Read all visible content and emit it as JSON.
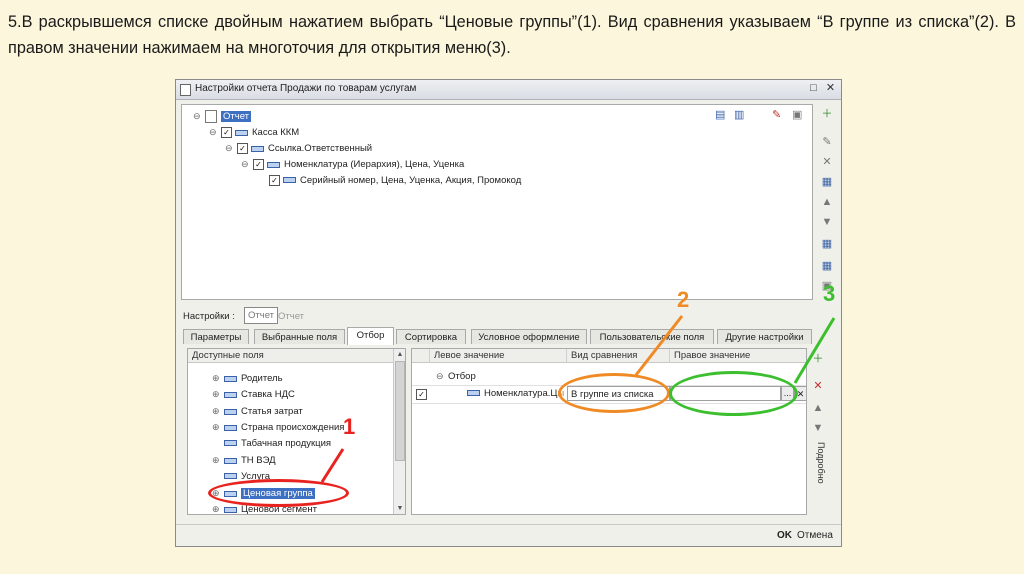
{
  "caption": "5.В раскрывшемся списке двойным нажатием выбрать “Ценовые группы”(1). Вид сравнения указываем “В группе из списка”(2). В правом значении нажимаем на многоточия для открытия меню(3).",
  "window": {
    "title": "Настройки отчета  Продажи по товарам услугам",
    "btn_restore": "□",
    "btn_close": "✕"
  },
  "tree": {
    "root": "Отчет",
    "items": [
      {
        "label": "Касса ККМ"
      },
      {
        "label": "Ссылка.Ответственный"
      },
      {
        "label": "Номенклатура (Иерархия), Цена, Уценка"
      },
      {
        "label": "Серийный номер, Цена, Уценка, Акция, Промокод"
      }
    ]
  },
  "settings": {
    "label": "Настройки :",
    "btn_active": "Отчет",
    "btn_inactive": "Отчет"
  },
  "tabs": [
    {
      "label": "Параметры"
    },
    {
      "label": "Выбранные поля"
    },
    {
      "label": "Отбор"
    },
    {
      "label": "Сортировка"
    },
    {
      "label": "Условное оформление"
    },
    {
      "label": "Пользовательские поля"
    },
    {
      "label": "Другие настройки"
    }
  ],
  "fields": {
    "header": "Доступные поля",
    "items": [
      {
        "label": "Родитель"
      },
      {
        "label": "Ставка НДС"
      },
      {
        "label": "Статья затрат"
      },
      {
        "label": "Страна происхождения"
      },
      {
        "label": "Табачная продукция"
      },
      {
        "label": "ТН ВЭД"
      },
      {
        "label": "Услуга"
      },
      {
        "label": "Ценовая группа"
      },
      {
        "label": "Ценовой сегмент"
      }
    ]
  },
  "filter": {
    "col_left": "Левое значение",
    "col_compare": "Вид сравнения",
    "col_right": "Правое значение",
    "group": "Отбор",
    "row_left": "Номенклатура.Ц",
    "row_left_tail": "ы",
    "row_compare": "В группе из списка",
    "row_right": "",
    "ellipsis": "...",
    "clear": "✕"
  },
  "side_label": "Подробно",
  "footer": {
    "ok": "OK",
    "cancel": "Отмена"
  },
  "annotations": {
    "n1": "1",
    "n2": "2",
    "n3": "3",
    "color_red": "#e8231f",
    "color_orange": "#f08a24",
    "color_green": "#3cbf2e"
  }
}
